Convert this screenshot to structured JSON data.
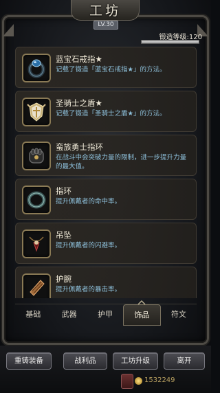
{
  "header": {
    "title": "工坊",
    "level": "LV.30",
    "forge_level": "锻造等级:120",
    "forge_progress": 1.0
  },
  "items": [
    {
      "name": "蓝宝石戒指★",
      "desc": "记载了锻造「蓝宝石戒指★」的方法。",
      "icon": "sapphire-ring-icon"
    },
    {
      "name": "圣骑士之盾★",
      "desc": "记载了锻造「圣骑士之盾★」的方法。",
      "icon": "paladin-shield-icon"
    },
    {
      "name": "蛮族勇士指环",
      "desc": "在战斗中会突破力量的限制，进一步提升力量的最大值。",
      "icon": "barbarian-ring-icon"
    },
    {
      "name": "指环",
      "desc": "提升佩戴者的命中率。",
      "icon": "ring-icon"
    },
    {
      "name": "吊坠",
      "desc": "提升佩戴者的闪避率。",
      "icon": "pendant-icon"
    },
    {
      "name": "护腕",
      "desc": "提升佩戴者的暴击率。",
      "icon": "bracer-icon"
    }
  ],
  "tabs": [
    {
      "label": "基础",
      "active": false
    },
    {
      "label": "武器",
      "active": false
    },
    {
      "label": "护甲",
      "active": false
    },
    {
      "label": "饰品",
      "active": true
    },
    {
      "label": "符文",
      "active": false
    }
  ],
  "buttons": {
    "recast": "重铸装备",
    "loot": "战利品",
    "upgrade": "工坊升级",
    "leave": "离开"
  },
  "gold": "1532249"
}
